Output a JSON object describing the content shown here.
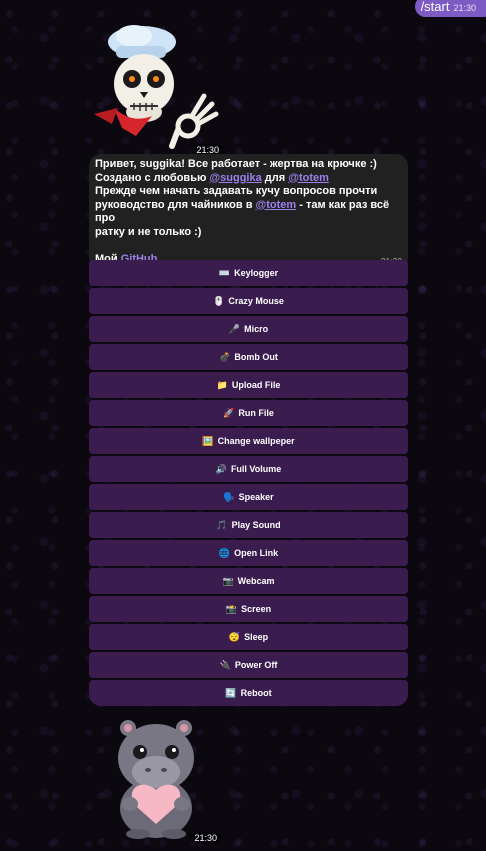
{
  "header": {
    "command": "/start",
    "command_time": "21:30"
  },
  "sticker_top": {
    "time": "21:30"
  },
  "message": {
    "line1": "Привет, suggika! Все работает - жертва на крючке :)",
    "line2_prefix": "Создано с любовью ",
    "line2_mention1": "@suggika",
    "line2_middle": " для ",
    "line2_mention2": "@totem",
    "line3": "Прежде чем начать задавать кучу вопросов прочти",
    "line4_prefix": "руководство для чайников в ",
    "line4_mention": "@totem",
    "line4_suffix": " - там как раз всё про",
    "line5": "ратку и не только :)",
    "github_prefix": "Мой ",
    "github_link": "GitHub",
    "time": "21:30"
  },
  "keyboard": [
    {
      "label": "Keylogger",
      "icon": "⌨️"
    },
    {
      "label": "Crazy Mouse",
      "icon": "🖱️"
    },
    {
      "label": "Micro",
      "icon": "🎤"
    },
    {
      "label": "Bomb Out",
      "icon": "💣"
    },
    {
      "label": "Upload File",
      "icon": "📁"
    },
    {
      "label": "Run File",
      "icon": "🚀"
    },
    {
      "label": "Change wallpeper",
      "icon": "🖼️"
    },
    {
      "label": "Full Volume",
      "icon": "🔊"
    },
    {
      "label": "Speaker",
      "icon": "🗣️"
    },
    {
      "label": "Play Sound",
      "icon": "🎵"
    },
    {
      "label": "Open Link",
      "icon": "🌐"
    },
    {
      "label": "Webcam",
      "icon": "📷"
    },
    {
      "label": "Screen",
      "icon": "📸"
    },
    {
      "label": "Sleep",
      "icon": "😴"
    },
    {
      "label": "Power Off",
      "icon": "🔌"
    },
    {
      "label": "Reboot",
      "icon": "🔄"
    }
  ],
  "sticker_bottom": {
    "time": "21:30"
  },
  "colors": {
    "accent": "#7c5cc4",
    "button": "#3b1c4f",
    "bubble": "#212121",
    "link": "#9e80ee"
  }
}
